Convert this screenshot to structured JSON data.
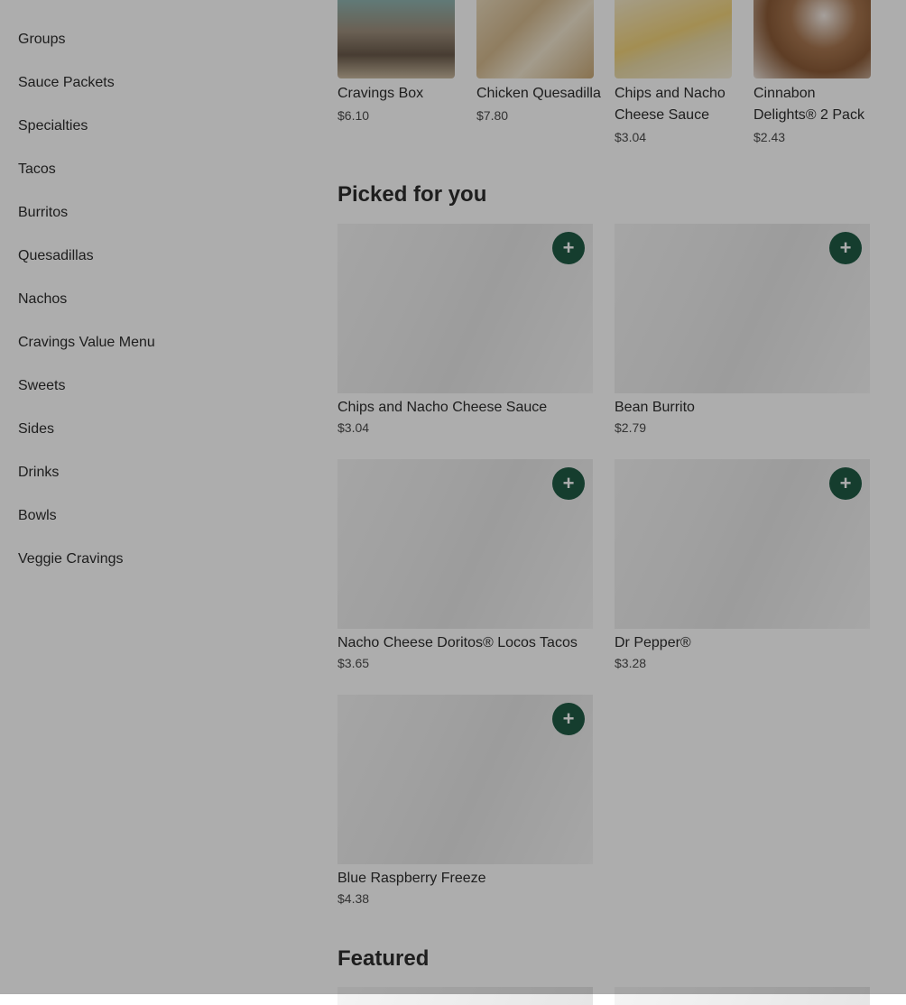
{
  "sidebar": {
    "items": [
      {
        "label": "Groups"
      },
      {
        "label": "Sauce Packets"
      },
      {
        "label": "Specialties"
      },
      {
        "label": "Tacos"
      },
      {
        "label": "Burritos"
      },
      {
        "label": "Quesadillas"
      },
      {
        "label": "Nachos"
      },
      {
        "label": "Cravings Value Menu"
      },
      {
        "label": "Sweets"
      },
      {
        "label": "Sides"
      },
      {
        "label": "Drinks"
      },
      {
        "label": "Bowls"
      },
      {
        "label": "Veggie Cravings"
      }
    ]
  },
  "top_row": [
    {
      "name": "Cravings Box",
      "price": "$6.10"
    },
    {
      "name": "Chicken Quesadilla",
      "price": "$7.80"
    },
    {
      "name": "Chips and Nacho Cheese Sauce",
      "price": "$3.04"
    },
    {
      "name": "Cinnabon Delights® 2 Pack",
      "price": "$2.43"
    }
  ],
  "picked": {
    "title": "Picked for you",
    "add_symbol": "+",
    "items": [
      {
        "name": "Chips and Nacho Cheese Sauce",
        "price": "$3.04"
      },
      {
        "name": "Bean Burrito",
        "price": "$2.79"
      },
      {
        "name": "Nacho Cheese Doritos® Locos Tacos",
        "price": "$3.65"
      },
      {
        "name": "Dr Pepper®",
        "price": "$3.28"
      },
      {
        "name": "Blue Raspberry Freeze",
        "price": "$4.38"
      }
    ]
  },
  "featured": {
    "title": "Featured"
  },
  "colors": {
    "add_button": "#1f5a45",
    "overlay": "rgba(0,0,0,0.32)"
  }
}
